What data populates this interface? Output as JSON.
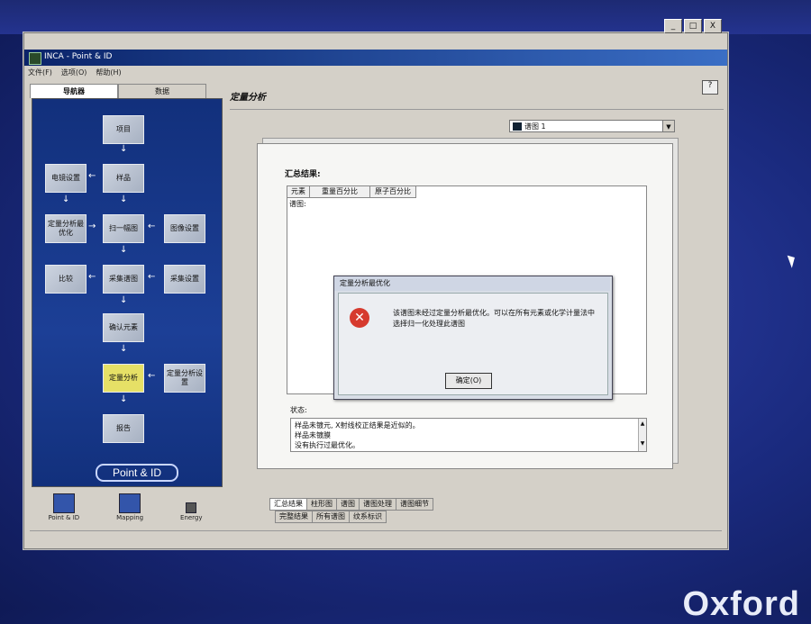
{
  "window": {
    "title": "INCA - Point & ID",
    "controls": [
      "_",
      "□",
      "X"
    ]
  },
  "menu": [
    "文件(F)",
    "选项(O)",
    "帮助(H)"
  ],
  "left_panel": {
    "tabs": [
      "导航器",
      "数据"
    ],
    "nav": {
      "project": "项目",
      "sample": "样品",
      "electron_setup": "电镜设置",
      "quant_opt": "定量分析最优化",
      "scan_image": "扫一幅图",
      "image_setup": "图像设置",
      "compare": "比较",
      "acquire_spectrum": "采集谱图",
      "acquire_setup": "采集设置",
      "confirm_elements": "确认元素",
      "quant_analysis": "定量分析",
      "quant_setup": "定量分析设置",
      "report": "报告"
    },
    "logo": "Point & ID",
    "bottom": {
      "point_id": "Point & ID",
      "mapping": "Mapping",
      "energy": "Energy"
    }
  },
  "main": {
    "section_title": "定量分析",
    "help_icon_label": "?",
    "spectrum_select": "谱图 1",
    "summary_title": "汇总结果:",
    "table": {
      "headers": [
        "元素",
        "重量百分比",
        "原子百分比"
      ],
      "first_cell": "谱图:"
    },
    "status_label": "状态:",
    "status_lines": [
      "样品未镀元, X射线校正结果是近似的。",
      "样品未镀膜",
      "没有执行过最优化。"
    ],
    "tabs_row1": [
      "汇总结果",
      "柱形图",
      "谱图",
      "谱图处理",
      "谱图细节"
    ],
    "tabs_row2": [
      "完整结果",
      "所有谱图",
      "纹系标识"
    ]
  },
  "dialog": {
    "title": "定量分析最优化",
    "message": "该谱图未经过定量分析最优化。可以在所有元素或化学计量法中选择归一化处理此谱图",
    "ok_button": "确定(O)"
  },
  "desktop": {
    "brand": "Oxford"
  }
}
